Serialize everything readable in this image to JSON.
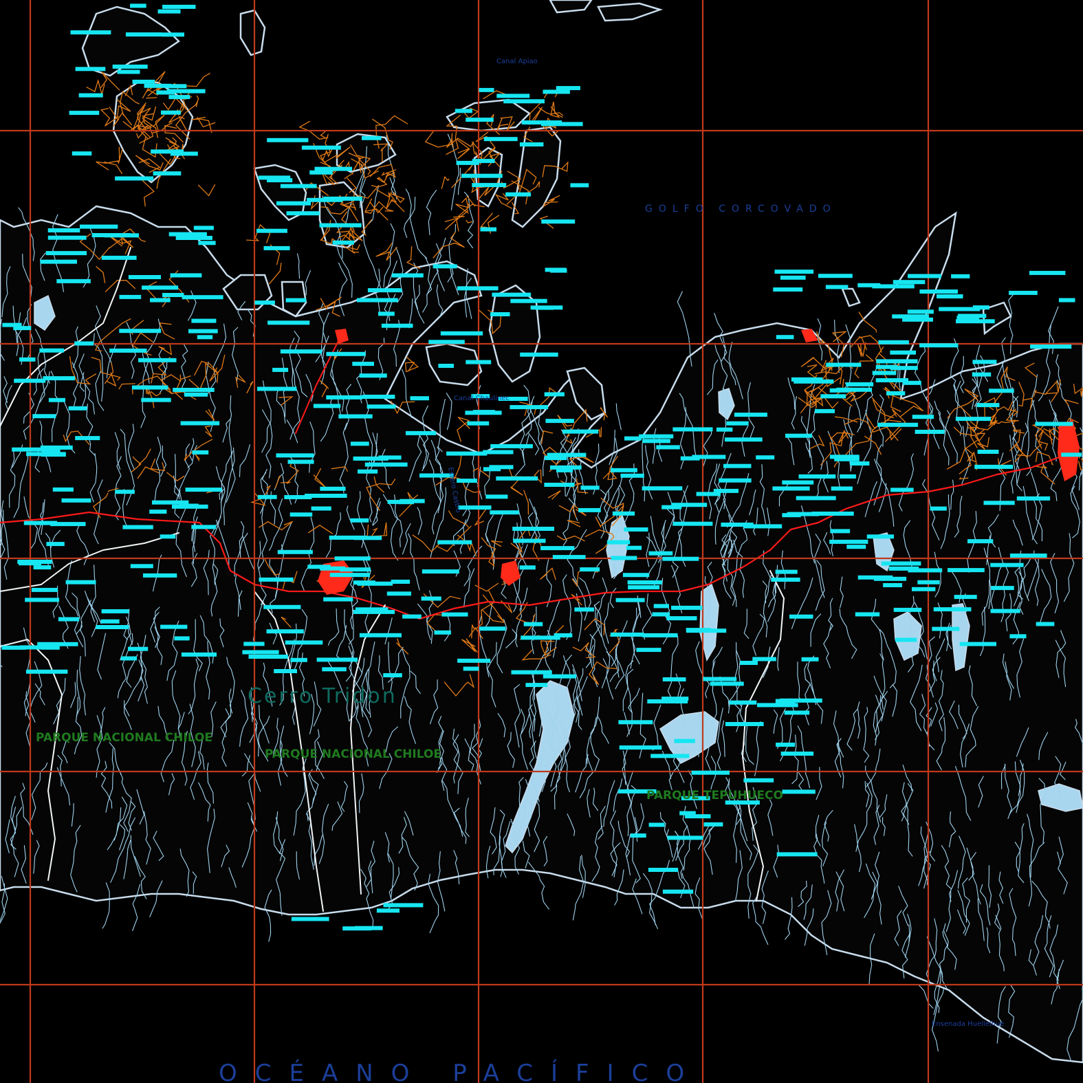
{
  "map": {
    "background": "#000000",
    "colors": {
      "grid": "#c0391b",
      "coast": "#c8dcec",
      "river": "#9fd3ee",
      "lake": "#a9d6ef",
      "track": "#e07a16",
      "road": "#ff1a1a",
      "label_box": "#16e6f2",
      "sea_text": "#1b3f9a",
      "park_text": "#1f7a1f"
    },
    "labels": {
      "gulf": "GOLFO CORCOVADO",
      "ocean": "OCÉANO PACÍFICO",
      "channel_north": "Canal Apiao",
      "channel_mid": "Canal Chaulinec",
      "estuary_mid": "Estero Castro",
      "park_west": "PARQUE NACIONAL CHILOE",
      "park_center": "PARQUE NACIONAL CHILOE",
      "park_east": "PARQUE TEPUHUECO",
      "mountain": "Cerro Tridon",
      "ensenada": "Ensenada Huellelhue"
    }
  }
}
